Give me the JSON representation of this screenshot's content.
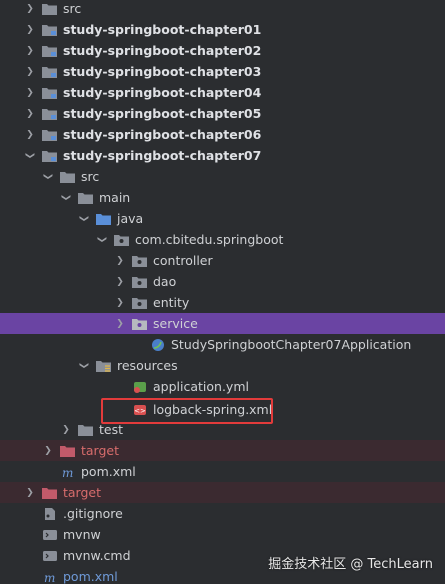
{
  "colors": {
    "background": "#2b2d30",
    "selected_row": "#6a44a3",
    "ignored_row": "#3b2a30",
    "highlight_border": "#e23b3b",
    "folder": "#8a8f98",
    "source_folder": "#5a8fd8",
    "excluded_folder": "#c25a6a",
    "package_icon": "#8a8f98"
  },
  "tree": {
    "rows": [
      {
        "label": "src",
        "icon": "folder-icon",
        "chevron": "right",
        "style": "normal"
      },
      {
        "label": "study-springboot-chapter01",
        "icon": "module-folder-icon",
        "chevron": "right",
        "style": "bold"
      },
      {
        "label": "study-springboot-chapter02",
        "icon": "module-folder-icon",
        "chevron": "right",
        "style": "bold"
      },
      {
        "label": "study-springboot-chapter03",
        "icon": "module-folder-icon",
        "chevron": "right",
        "style": "bold"
      },
      {
        "label": "study-springboot-chapter04",
        "icon": "module-folder-icon",
        "chevron": "right",
        "style": "bold"
      },
      {
        "label": "study-springboot-chapter05",
        "icon": "module-folder-icon",
        "chevron": "right",
        "style": "bold"
      },
      {
        "label": "study-springboot-chapter06",
        "icon": "module-folder-icon",
        "chevron": "right",
        "style": "bold"
      },
      {
        "label": "study-springboot-chapter07",
        "icon": "module-folder-icon",
        "chevron": "down",
        "style": "bold"
      },
      {
        "label": "src",
        "icon": "folder-icon",
        "chevron": "down",
        "style": "normal"
      },
      {
        "label": "main",
        "icon": "folder-icon",
        "chevron": "down",
        "style": "normal"
      },
      {
        "label": "java",
        "icon": "source-folder-icon",
        "chevron": "down",
        "style": "normal"
      },
      {
        "label": "com.cbitedu.springboot",
        "icon": "package-icon",
        "chevron": "down",
        "style": "normal"
      },
      {
        "label": "controller",
        "icon": "package-icon",
        "chevron": "right",
        "style": "normal"
      },
      {
        "label": "dao",
        "icon": "package-icon",
        "chevron": "right",
        "style": "normal"
      },
      {
        "label": "entity",
        "icon": "package-icon",
        "chevron": "right",
        "style": "normal"
      },
      {
        "label": "service",
        "icon": "package-icon",
        "chevron": "right",
        "style": "selected"
      },
      {
        "label": "StudySpringbootChapter07Application",
        "icon": "spring-class-icon",
        "chevron": "none",
        "style": "normal"
      },
      {
        "label": "resources",
        "icon": "resources-folder-icon",
        "chevron": "down",
        "style": "normal"
      },
      {
        "label": "application.yml",
        "icon": "spring-yml-icon",
        "chevron": "none",
        "style": "normal"
      },
      {
        "label": "logback-spring.xml",
        "icon": "xml-file-icon",
        "chevron": "none",
        "style": "normal"
      },
      {
        "label": "test",
        "icon": "folder-icon",
        "chevron": "right",
        "style": "normal"
      },
      {
        "label": "target",
        "icon": "excluded-folder-icon",
        "chevron": "right",
        "style": "ignored"
      },
      {
        "label": "pom.xml",
        "icon": "maven-icon",
        "chevron": "none",
        "style": "normal"
      },
      {
        "label": "target",
        "icon": "excluded-folder-icon",
        "chevron": "right",
        "style": "ignored"
      },
      {
        "label": ".gitignore",
        "icon": "gitignore-icon",
        "chevron": "none",
        "style": "normal"
      },
      {
        "label": "mvnw",
        "icon": "script-file-icon",
        "chevron": "none",
        "style": "normal"
      },
      {
        "label": "mvnw.cmd",
        "icon": "script-file-icon",
        "chevron": "none",
        "style": "normal"
      },
      {
        "label": "pom.xml",
        "icon": "maven-icon",
        "chevron": "none",
        "style": "normal"
      }
    ]
  },
  "watermark": "掘金技术社区 @ TechLearn"
}
